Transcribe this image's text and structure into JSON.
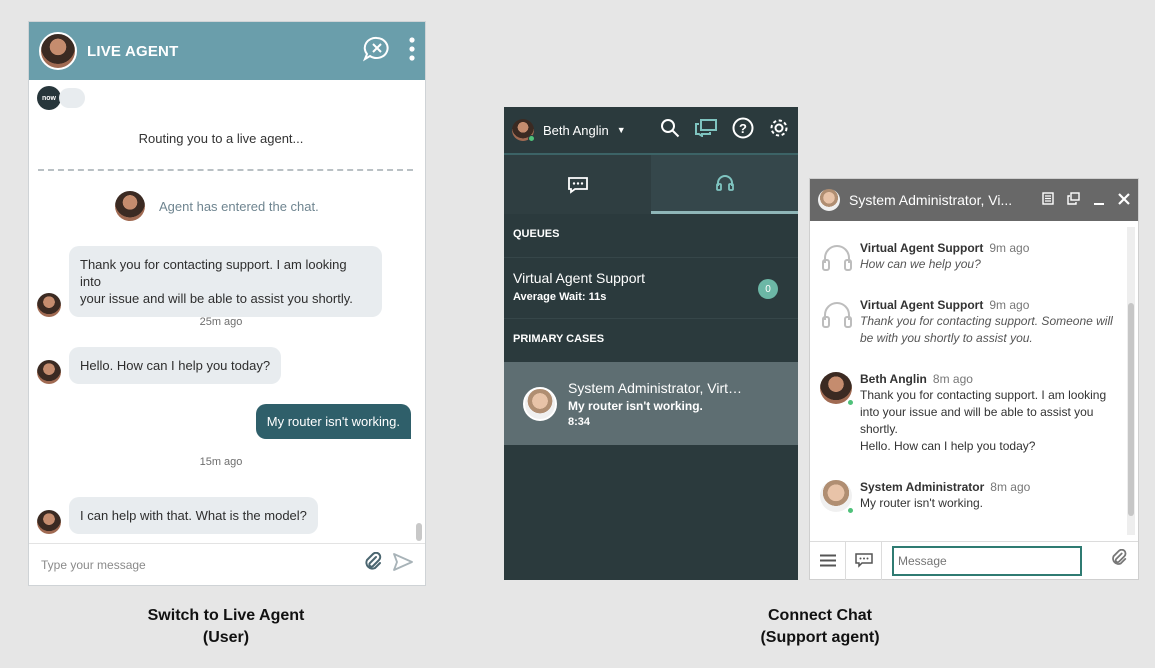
{
  "user_widget": {
    "title": "LIVE AGENT",
    "now_logo": "now",
    "routing_text": "Routing you to a live agent...",
    "agent_entered": "Agent has entered the chat.",
    "messages": [
      {
        "text_lines": [
          "Thank you for contacting support.  I am looking into",
          "your issue and will be able to assist you shortly."
        ]
      },
      {
        "text": "Hello. How can I help you today?"
      },
      {
        "text": "I can help with that. What is the model?"
      }
    ],
    "user_message": "My router isn't working.",
    "times": [
      "25m ago",
      "15m ago"
    ],
    "input_placeholder": "Type your message",
    "icons": [
      "close-chat-icon",
      "kebab-menu-icon",
      "paperclip-icon",
      "send-icon"
    ]
  },
  "captions": {
    "left": [
      "Switch to Live Agent",
      "(User)"
    ],
    "right": [
      "Connect Chat",
      "(Support agent)"
    ]
  },
  "agent_panel": {
    "user_name": "Beth Anglin",
    "icons": [
      "search-icon",
      "chat-windows-icon",
      "help-icon",
      "gear-icon"
    ],
    "queues_label": "QUEUES",
    "queue": {
      "name": "Virtual Agent Support",
      "wait": "Average Wait: 11s",
      "count": "0"
    },
    "primary_label": "PRIMARY CASES",
    "case": {
      "title": "System Administrator, Virt…",
      "subtitle": "My router isn't working.",
      "time": "8:34"
    }
  },
  "chat_window": {
    "title": "System Administrator, Vi...",
    "messages": [
      {
        "sender": "Virtual Agent Support",
        "time": "9m ago",
        "lines": [
          "How can we help you?"
        ],
        "italic": true
      },
      {
        "sender": "Virtual Agent Support",
        "time": "9m ago",
        "lines": [
          "Thank you for contacting support. Someone will",
          "be with you shortly to assist you."
        ],
        "italic": true
      },
      {
        "sender": "Beth Anglin",
        "time": "8m ago",
        "lines": [
          "Thank you for contacting support.  I am looking",
          "into your issue and will be able to assist you",
          "shortly.",
          "Hello. How can I help you today?"
        ],
        "italic": false
      },
      {
        "sender": "System Administrator",
        "time": "8m ago",
        "lines": [
          "My router isn't working."
        ],
        "italic": false
      }
    ],
    "input_placeholder": "Message"
  },
  "colors": {
    "widget_header": "#6a9eab",
    "user_bubble": "#2f5f6a",
    "agent_panel_bg": "#2b3a3d",
    "accent": "#2f7b72",
    "presence": "#4fc17a"
  }
}
